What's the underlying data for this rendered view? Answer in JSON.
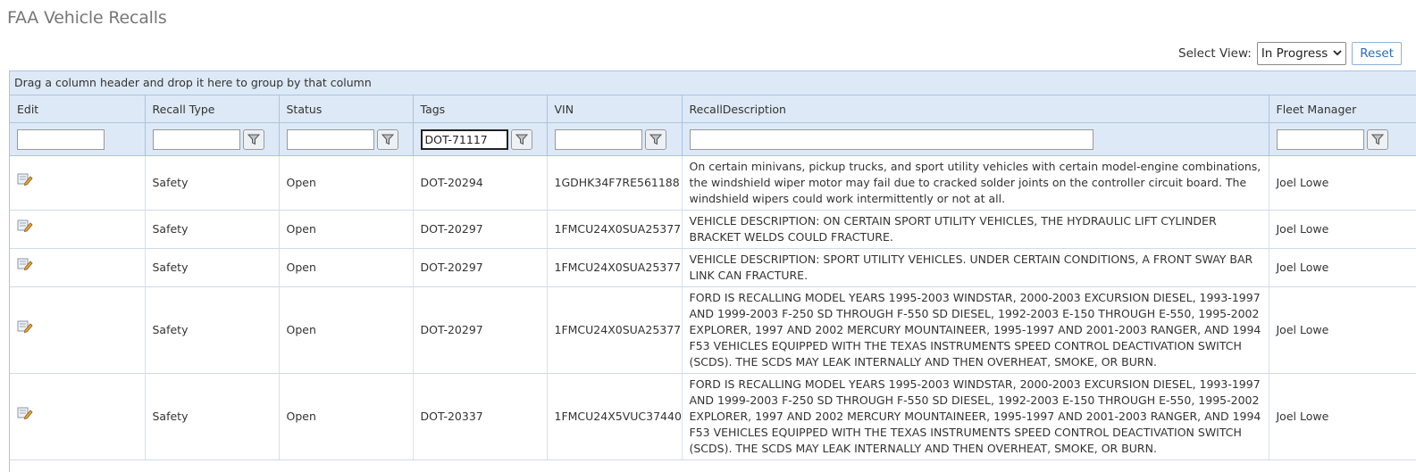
{
  "page": {
    "title": "FAA Vehicle Recalls"
  },
  "toolbar": {
    "select_view_label": "Select View:",
    "selected_view": "In Progress",
    "reset_label": "Reset"
  },
  "grid": {
    "group_panel_text": "Drag a column header and drop it here to group by that column",
    "columns": [
      "Edit",
      "Recall Type",
      "Status",
      "Tags",
      "VIN",
      "RecallDescription",
      "Fleet Manager"
    ],
    "filters": {
      "recall_type": "",
      "status": "",
      "tags": "DOT-71117",
      "vin": "",
      "recall_description": "",
      "fleet_manager": ""
    },
    "rows": [
      {
        "recall_type": "Safety",
        "status": "Open",
        "tags": "DOT-20294",
        "vin": "1GDHK34F7RE561188",
        "description": "On certain minivans, pickup trucks, and sport utility vehicles with certain model-engine combinations, the windshield wiper motor may fail due to cracked solder joints on the controller circuit board. The windshield wipers could work intermittently or not at all.",
        "fleet_manager": "Joel Lowe"
      },
      {
        "recall_type": "Safety",
        "status": "Open",
        "tags": "DOT-20297",
        "vin": "1FMCU24X0SUA25377",
        "description": "VEHICLE DESCRIPTION: ON CERTAIN SPORT UTILITY VEHICLES, THE HYDRAULIC LIFT CYLINDER BRACKET WELDS COULD FRACTURE.",
        "fleet_manager": "Joel Lowe"
      },
      {
        "recall_type": "Safety",
        "status": "Open",
        "tags": "DOT-20297",
        "vin": "1FMCU24X0SUA25377",
        "description": "VEHICLE DESCRIPTION: SPORT UTILITY VEHICLES. UNDER CERTAIN CONDITIONS, A FRONT SWAY BAR LINK CAN FRACTURE.",
        "fleet_manager": "Joel Lowe"
      },
      {
        "recall_type": "Safety",
        "status": "Open",
        "tags": "DOT-20297",
        "vin": "1FMCU24X0SUA25377",
        "description": "FORD IS RECALLING MODEL YEARS 1995-2003 WINDSTAR, 2000-2003 EXCURSION DIESEL, 1993-1997 AND 1999-2003 F-250 SD THROUGH F-550 SD DIESEL, 1992-2003 E-150 THROUGH E-550, 1995-2002 EXPLORER, 1997 AND 2002 MERCURY MOUNTAINEER, 1995-1997 AND 2001-2003 RANGER, AND 1994 F53 VEHICLES EQUIPPED WITH THE TEXAS INSTRUMENTS SPEED CONTROL DEACTIVATION SWITCH (SCDS). THE SCDS MAY LEAK INTERNALLY AND THEN OVERHEAT, SMOKE, OR BURN.",
        "fleet_manager": "Joel Lowe"
      },
      {
        "recall_type": "Safety",
        "status": "Open",
        "tags": "DOT-20337",
        "vin": "1FMCU24X5VUC37440",
        "description": "FORD IS RECALLING MODEL YEARS 1995-2003 WINDSTAR, 2000-2003 EXCURSION DIESEL, 1993-1997 AND 1999-2003 F-250 SD THROUGH F-550 SD DIESEL, 1992-2003 E-150 THROUGH E-550, 1995-2002 EXPLORER, 1997 AND 2002 MERCURY MOUNTAINEER, 1995-1997 AND 2001-2003 RANGER, AND 1994 F53 VEHICLES EQUIPPED WITH THE TEXAS INSTRUMENTS SPEED CONTROL DEACTIVATION SWITCH (SCDS). THE SCDS MAY LEAK INTERNALLY AND THEN OVERHEAT, SMOKE, OR BURN.",
        "fleet_manager": "Joel Lowe"
      }
    ]
  },
  "icons": {
    "edit": "edit-pencil-icon",
    "filter": "filter-funnel-icon",
    "dropdown": "chevron-down-icon"
  },
  "colors": {
    "header_bg": "#dde9f6",
    "border": "#a9c4e4",
    "link": "#2a6db5"
  }
}
